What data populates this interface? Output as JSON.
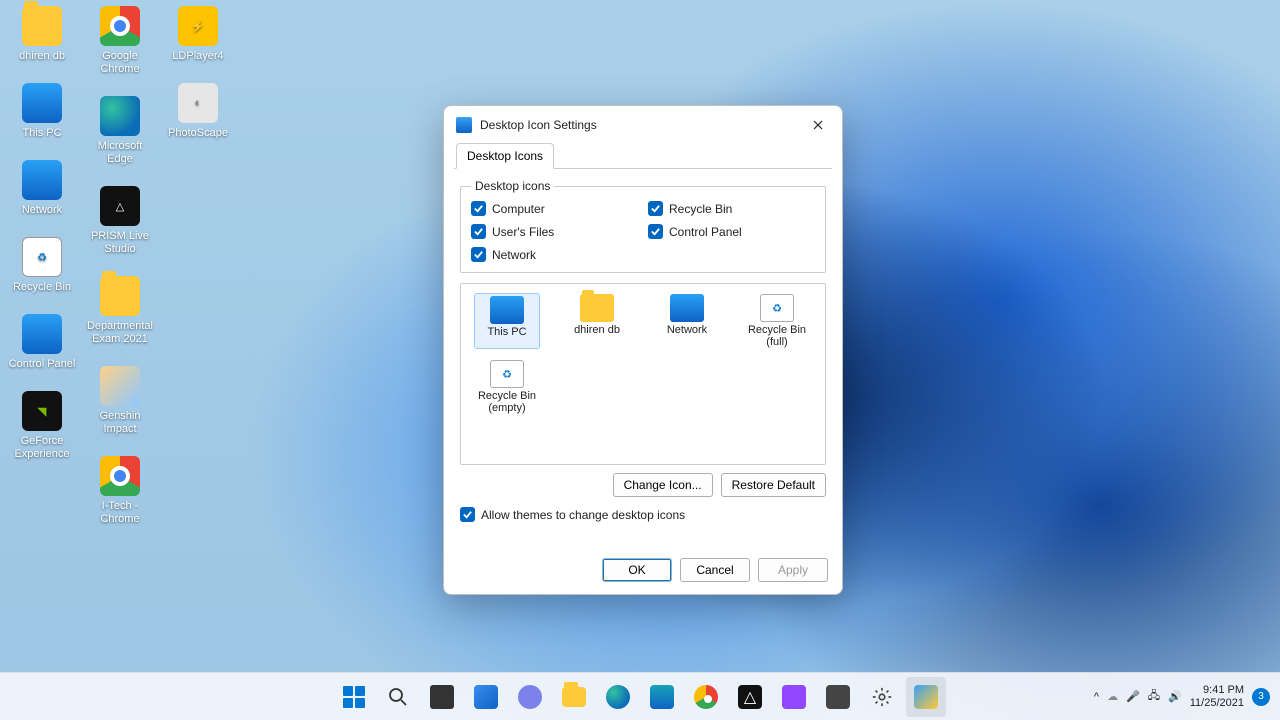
{
  "desktop": {
    "icons_col1": [
      {
        "label": "dhiren db",
        "kind": "folder"
      },
      {
        "label": "This PC",
        "kind": "pc"
      },
      {
        "label": "Network",
        "kind": "net"
      },
      {
        "label": "Recycle Bin",
        "kind": "recycle"
      },
      {
        "label": "Control Panel",
        "kind": "cpanel"
      },
      {
        "label": "GeForce Experience",
        "kind": "geforce"
      }
    ],
    "icons_col2": [
      {
        "label": "Google Chrome",
        "kind": "chrome"
      },
      {
        "label": "Microsoft Edge",
        "kind": "edge"
      },
      {
        "label": "PRISM Live Studio",
        "kind": "prism"
      },
      {
        "label": "Departmental Exam 2021",
        "kind": "folder"
      },
      {
        "label": "Genshin Impact",
        "kind": "genshin"
      },
      {
        "label": "I-Tech - Chrome",
        "kind": "chrome"
      }
    ],
    "icons_col3": [
      {
        "label": "LDPlayer4",
        "kind": "ld"
      },
      {
        "label": "PhotoScape",
        "kind": "photoscape"
      }
    ]
  },
  "dialog": {
    "title": "Desktop Icon Settings",
    "tab": "Desktop Icons",
    "legend": "Desktop icons",
    "checks": {
      "computer": "Computer",
      "users_files": "User's Files",
      "network": "Network",
      "recycle_bin": "Recycle Bin",
      "control_panel": "Control Panel"
    },
    "preview": {
      "this_pc": "This PC",
      "user_folder": "dhiren db",
      "network": "Network",
      "recycle_full": "Recycle Bin (full)",
      "recycle_empty": "Recycle Bin (empty)"
    },
    "buttons": {
      "change_icon": "Change Icon...",
      "restore_default": "Restore Default"
    },
    "allow_themes": "Allow themes to change desktop icons",
    "footer": {
      "ok": "OK",
      "cancel": "Cancel",
      "apply": "Apply"
    }
  },
  "taskbar": {
    "time": "9:41 PM",
    "date": "11/25/2021",
    "notif_count": "3"
  }
}
